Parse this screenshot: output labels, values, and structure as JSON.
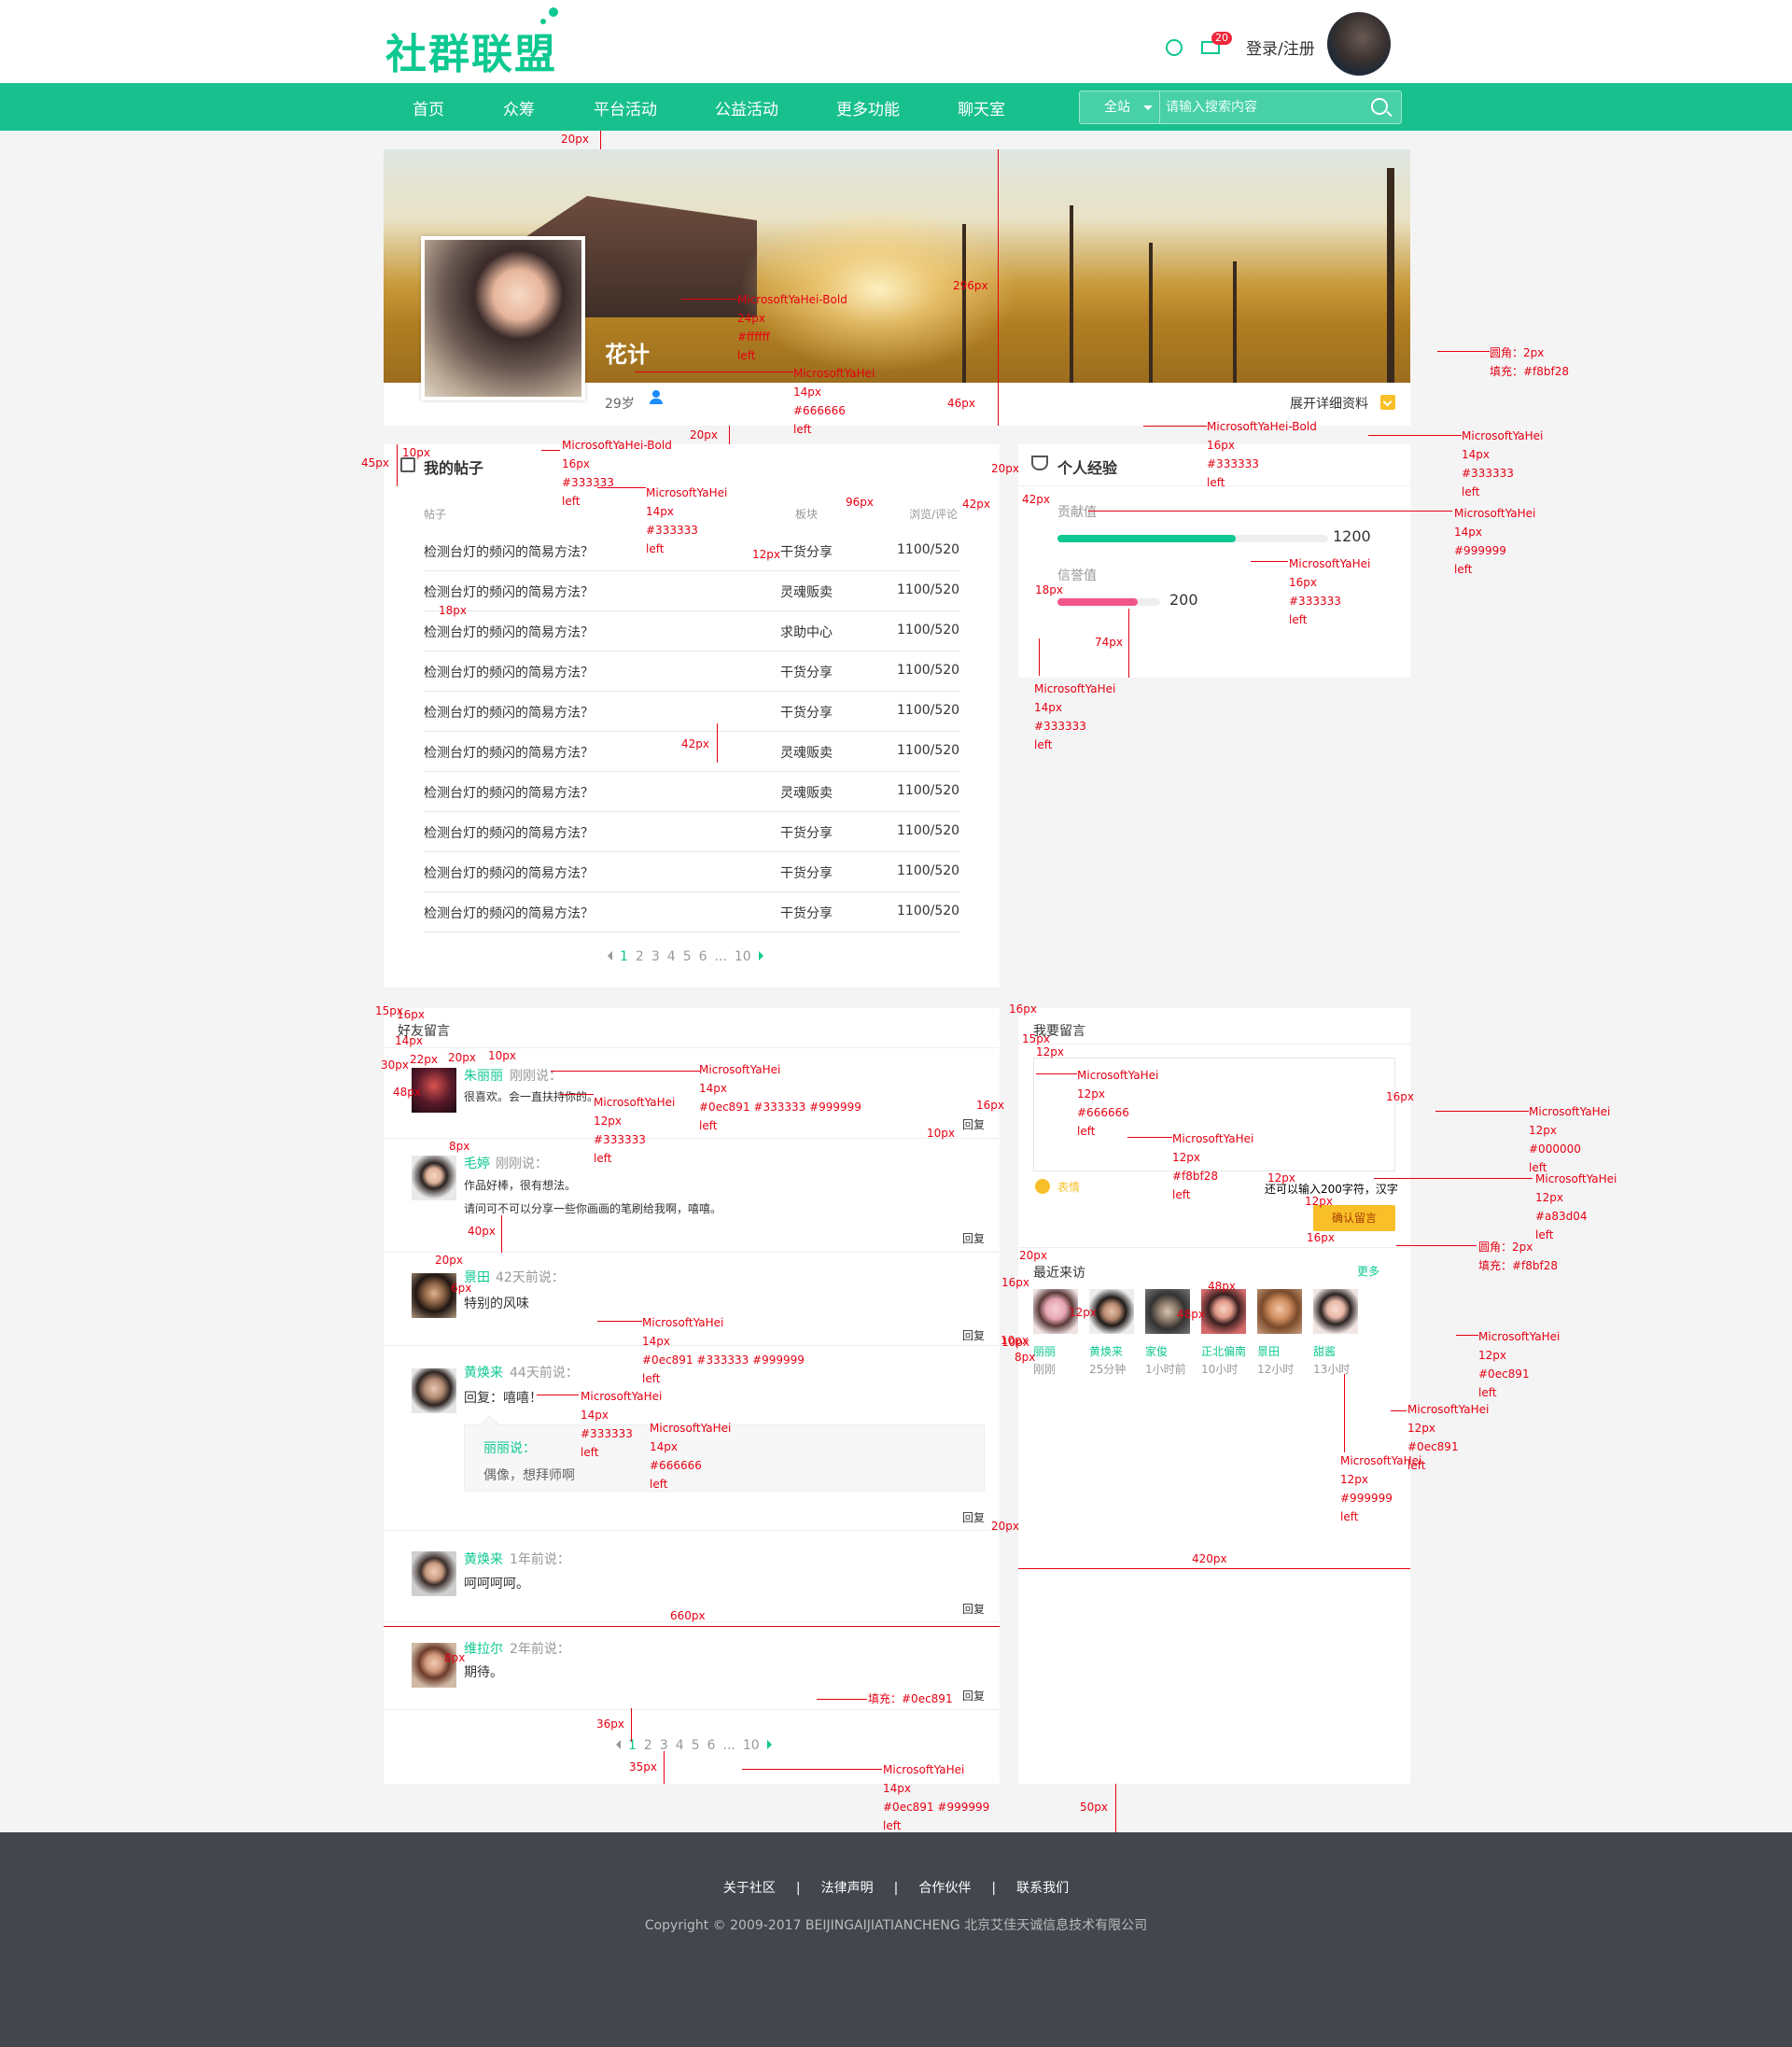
{
  "header": {
    "logo": "社群联盟",
    "mail_badge": "20",
    "login_label": "登录/注册"
  },
  "nav": {
    "items": [
      "首页",
      "众筹",
      "平台活动",
      "公益活动",
      "更多功能",
      "聊天室"
    ],
    "search_scope": "全站",
    "search_placeholder": "请输入搜索内容"
  },
  "profile": {
    "name": "花计",
    "age": "29岁",
    "expand_label": "展开详细资料"
  },
  "posts": {
    "title": "我的帖子",
    "columns": [
      "帖子",
      "板块",
      "浏览/评论"
    ],
    "rows": [
      {
        "title": "检测台灯的频闪的简易方法？",
        "board": "干货分享",
        "stats": "1100/520"
      },
      {
        "title": "检测台灯的频闪的简易方法？",
        "board": "灵魂贩卖",
        "stats": "1100/520"
      },
      {
        "title": "检测台灯的频闪的简易方法？",
        "board": "求助中心",
        "stats": "1100/520"
      },
      {
        "title": "检测台灯的频闪的简易方法？",
        "board": "干货分享",
        "stats": "1100/520"
      },
      {
        "title": "检测台灯的频闪的简易方法？",
        "board": "干货分享",
        "stats": "1100/520"
      },
      {
        "title": "检测台灯的频闪的简易方法？",
        "board": "灵魂贩卖",
        "stats": "1100/520"
      },
      {
        "title": "检测台灯的频闪的简易方法？",
        "board": "灵魂贩卖",
        "stats": "1100/520"
      },
      {
        "title": "检测台灯的频闪的简易方法？",
        "board": "干货分享",
        "stats": "1100/520"
      },
      {
        "title": "检测台灯的频闪的简易方法？",
        "board": "干货分享",
        "stats": "1100/520"
      },
      {
        "title": "检测台灯的频闪的简易方法？",
        "board": "干货分享",
        "stats": "1100/520"
      }
    ],
    "pager": [
      "1",
      "2",
      "3",
      "4",
      "5",
      "6",
      "...",
      "10"
    ]
  },
  "experience": {
    "title": "个人经验",
    "contrib_label": "贡献值",
    "contrib_value": "1200",
    "contrib_fraction": 0.66,
    "credit_label": "信誉值",
    "credit_value": "200",
    "credit_fraction": 0.78,
    "contrib_color": "#0ec891",
    "credit_color": "#f0558c"
  },
  "friends": {
    "title": "好友留言",
    "reply_label": "回复",
    "messages": [
      {
        "name": "朱丽丽",
        "time": "刚刚说：",
        "text": "很喜欢。会一直扶持你的。"
      },
      {
        "name": "毛婷",
        "time": "刚刚说：",
        "text": "作品好棒，很有想法。",
        "text2": "请问可不可以分享一些你画画的笔刷给我啊，嘻嘻。"
      },
      {
        "name": "景田",
        "time": "42天前说：",
        "text": "特别的风味"
      },
      {
        "name": "黄焕来",
        "time": "44天前说：",
        "text": "回复：嘻嘻！",
        "quote_name": "丽丽说：",
        "quote_text": "偶像，想拜师啊"
      },
      {
        "name": "黄焕来",
        "time": "1年前说：",
        "text": "呵呵呵呵。"
      },
      {
        "name": "维拉尔",
        "time": "2年前说：",
        "text": "期待。"
      }
    ],
    "pager": [
      "1",
      "2",
      "3",
      "4",
      "5",
      "6",
      "...",
      "10"
    ]
  },
  "leave_message": {
    "title": "我要留言",
    "emoji_label": "表情",
    "remaining": "还可以输入200字符，汉字",
    "confirm_label": "确认留言"
  },
  "visitors": {
    "title": "最近来访",
    "more_label": "更多",
    "list": [
      {
        "name": "丽丽",
        "time": "刚刚"
      },
      {
        "name": "黄焕来",
        "time": "25分钟"
      },
      {
        "name": "家俊",
        "time": "1小时前"
      },
      {
        "name": "正北偏南",
        "time": "10小时"
      },
      {
        "name": "景田",
        "time": "12小时"
      },
      {
        "name": "甜酱",
        "time": "13小时"
      }
    ]
  },
  "footer": {
    "links": [
      "关于社区",
      "|",
      "法律声明",
      "|",
      "合作伙伴",
      "|",
      "联系我们"
    ],
    "copyright": "Copyright © 2009-2017 BEIJINGAIJIATIANCHENG 北京艾佳天诚信息技术有限公司"
  },
  "annotations": {
    "a_20px": "20px",
    "a_296px": "296px",
    "a_46px": "46px",
    "a_20px_b": "20px",
    "a_45px": "45px",
    "a_10px": "10px",
    "a_bold24": "MicrosoftYaHei-Bold",
    "a_24px": "24px",
    "a_ffffff": "#ffffff",
    "a_left1": "left",
    "a_yh14": "MicrosoftYaHei",
    "a_14px": "14px",
    "a_666": "#666666",
    "a_left2": "left",
    "a_radius": "圆角：2px",
    "a_fill": "填充：#f8bf28",
    "a_yh14b": "MicrosoftYaHei",
    "a_14pxb": "14px",
    "a_333": "#333333",
    "a_left3": "left",
    "a_bold16": "MicrosoftYaHei-Bold",
    "a_16px": "16px",
    "a_333b": "#333333",
    "a_left4": "left",
    "a_bold16b": "MicrosoftYaHei-Bold",
    "a_16pxb": "16px",
    "a_333c": "#333333",
    "a_left5": "left",
    "a_yh14c": "MicrosoftYaHei",
    "a_14pxc": "14px",
    "a_333d": "#333333",
    "a_left6": "left",
    "a_96px": "96px",
    "a_42px": "42px",
    "a_42pxb": "42px",
    "a_20pxc": "20px",
    "a_12px": "12px",
    "a_18px": "18px",
    "a_42pxc": "42px",
    "a_yh14d": "MicrosoftYaHei",
    "a_14pxd": "14px",
    "a_999": "#999999",
    "a_left7": "left",
    "a_yh16": "MicrosoftYaHei",
    "a_16pxc": "16px",
    "a_333e": "#333333",
    "a_left8": "left",
    "a_18pxb": "18px",
    "a_74px": "74px",
    "a_yh14e": "MicrosoftYaHei",
    "a_14pxe": "14px",
    "a_333f": "#333333",
    "a_left9": "left",
    "a_15px": "15px",
    "a_16pxd": "16px",
    "a_14pxf": "14px",
    "a_30px": "30px",
    "a_48px": "48px",
    "a_22px": "22px",
    "a_20pxd": "20px",
    "a_10pxb": "10px",
    "a_yh14f": "MicrosoftYaHei",
    "a_14pxg": "14px",
    "a_colors1": "#0ec891 #333333 #999999",
    "a_left10": "left",
    "a_yh12": "MicrosoftYaHei",
    "a_12pxb": "12px",
    "a_333g": "#333333",
    "a_left11": "left",
    "a_16pxe": "16px",
    "a_10pxc": "10px",
    "a_8px": "8px",
    "a_40px": "40px",
    "a_20pxe": "20px",
    "a_6px": "6px",
    "a_yh14g": "MicrosoftYaHei",
    "a_14pxh": "14px",
    "a_colors2": "#0ec891 #333333 #999999",
    "a_left12": "left",
    "a_yh14h": "MicrosoftYaHei",
    "a_14pxi": "14px",
    "a_333h": "#333333",
    "a_left13": "left",
    "a_yh14i": "MicrosoftYaHei",
    "a_14pxj": "14px",
    "a_666b": "#666666",
    "a_left14": "left",
    "a_660px": "660px",
    "a_8pxb": "8px",
    "a_36px": "36px",
    "a_35px": "35px",
    "a_fill2": "填充：#0ec891",
    "a_yh14j": "MicrosoftYaHei",
    "a_14pxk": "14px",
    "a_colors3": "#0ec891 #999999",
    "a_left15": "left",
    "a_16pxf": "16px",
    "a_15pxb": "15px",
    "a_12pxc": "12px",
    "a_yh12b": "MicrosoftYaHei",
    "a_12pxd": "12px",
    "a_666c": "#666666",
    "a_left16": "left",
    "a_16pxg": "16px",
    "a_10pxd": "10px",
    "a_yh12c": "MicrosoftYaHei",
    "a_12pxe": "12px",
    "a_f8bf28": "#f8bf28",
    "a_left17": "left",
    "a_12pxf": "12px",
    "a_12pxg": "12px",
    "a_16pxh": "16px",
    "a_yh12d": "MicrosoftYaHei",
    "a_12pxh": "12px",
    "a_000": "#000000",
    "a_left18": "left",
    "a_yh12e": "MicrosoftYaHei",
    "a_12pxi": "12px",
    "a_a83d04": "#a83d04",
    "a_left19": "left",
    "a_radius2": "圆角：2px",
    "a_fill3": "填充：#f8bf28",
    "a_20pxf": "20px",
    "a_16pxi": "16px",
    "a_12pxj": "12px",
    "a_48pxb": "48px",
    "a_48pxc": "48px",
    "a_10pxe": "10px",
    "a_8pxc": "8px",
    "a_yh12f": "MicrosoftYaHei",
    "a_12pxk": "12px",
    "a_0ec891": "#0ec891",
    "a_left20": "left",
    "a_yh12g": "MicrosoftYaHei",
    "a_12pxl": "12px",
    "a_0ec891b": "#0ec891",
    "a_left21": "left",
    "a_yh12h": "MicrosoftYaHei",
    "a_12pxm": "12px",
    "a_999b": "#999999",
    "a_left22": "left",
    "a_20pxg": "20px",
    "a_420px": "420px",
    "a_50px": "50px"
  }
}
